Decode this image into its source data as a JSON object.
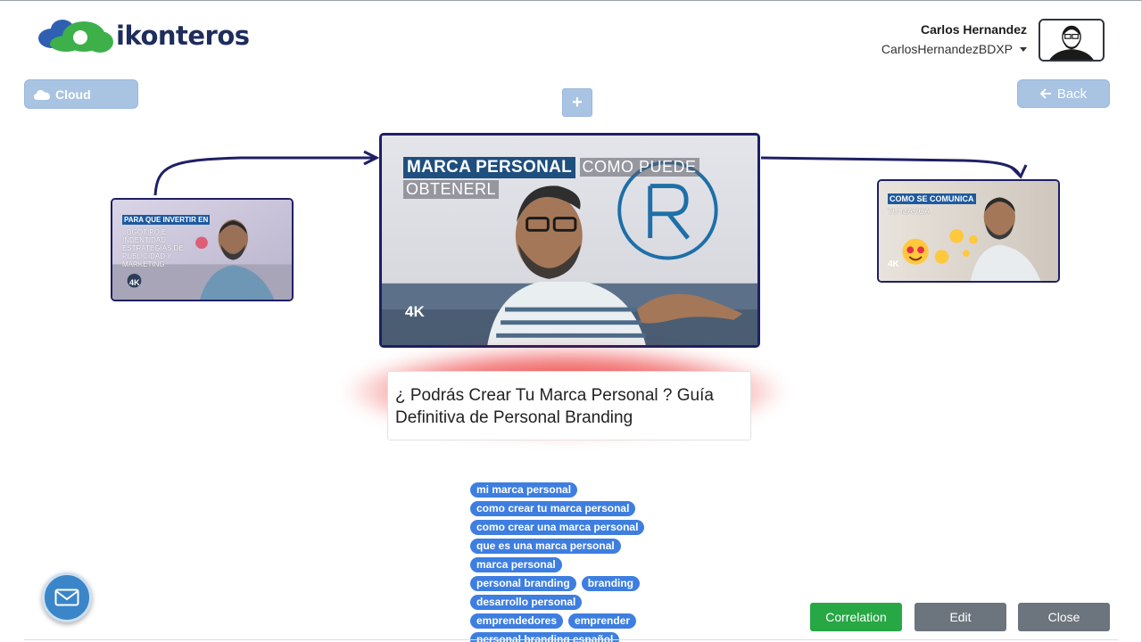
{
  "brand": {
    "name": "ikonteros"
  },
  "user": {
    "name": "Carlos Hernandez",
    "handle": "CarlosHernandezBDXP"
  },
  "toolbar": {
    "cloud_label": "Cloud",
    "back_label": "Back",
    "add_label": "+"
  },
  "videos": {
    "main": {
      "overlay_title": "MARCA PERSONAL",
      "overlay_line1": "COMO PUEDE",
      "overlay_line2": "OBTENERL",
      "badge": "4K",
      "caption": "¿ Podrás Crear Tu Marca Personal ? Guía Definitiva de Personal Branding"
    },
    "previous": {
      "overlay_title": "PARA QUE INVERTIR EN",
      "overlay_lines": [
        "LOGOTIPO E",
        "INDENTIDAD",
        "ESTRATEGIAS DE",
        "PUBLICIDAD Y",
        "MARKETING"
      ],
      "badge": "4K"
    },
    "next": {
      "overlay_title": "COMO SE COMUNICA",
      "overlay_line1": "TU MARCA",
      "badge": "4K"
    }
  },
  "tags": [
    [
      "mi marca personal"
    ],
    [
      "como crear tu marca personal"
    ],
    [
      "como crear una marca personal"
    ],
    [
      "que es una marca personal"
    ],
    [
      "marca personal"
    ],
    [
      "personal branding",
      "branding"
    ],
    [
      "desarrollo personal"
    ],
    [
      "emprendedores",
      "emprender"
    ],
    [
      "personal branding español"
    ]
  ],
  "actions": {
    "correlation": "Correlation",
    "edit": "Edit",
    "close": "Close"
  },
  "colors": {
    "accent_soft": "#a9c3e3",
    "tag": "#3d7ee0",
    "success": "#28a745",
    "secondary": "#6c757d",
    "frame": "#1f1f66"
  }
}
